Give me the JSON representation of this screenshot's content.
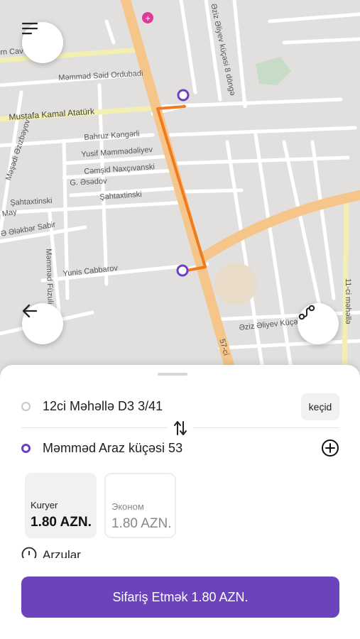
{
  "map": {
    "street_labels": [
      "Mustafa Kamal Atatürk",
      "Məmməd Səid Ordubadi",
      "Bahruz Kəngərli",
      "Yusif Məmmədəliyev",
      "Cəmşid Naxçıvanski",
      "G. Əsədov",
      "Şahtaxtinski",
      "Şahtaxtinski",
      "Yunis Cabbarov",
      "Məmməd Füzuli",
      "Əziz Əliyev küçəsi 8 döngə",
      "Əziz Əliyev Küçəsi",
      "Məşədi Əzizbəyov",
      "Ə Ələkbər Sabir",
      "11-ci məhəllə",
      "57-ci",
      "May",
      "rn Cav"
    ]
  },
  "controls": {
    "menu_icon": "hamburger-menu-icon",
    "back_icon": "arrow-left-icon",
    "route_icon": "route-icon"
  },
  "trip": {
    "pickup": "12ci Məhəllə D3 3/41",
    "destination": "Məmməd Araz küçəsi 53",
    "pickup_action": "keçid",
    "swap_icon": "swap-arrows-icon",
    "add_stop_icon": "plus-circle-icon"
  },
  "tariffs": [
    {
      "name": "Kuryer",
      "price": "1.80 AZN.",
      "selected": true
    },
    {
      "name": "Эконом",
      "price": "1.80 AZN.",
      "selected": false
    }
  ],
  "wishes_label": "Arzular",
  "order_button": "Sifariş Etmək 1.80 AZN.",
  "colors": {
    "accent": "#6b43bd",
    "route": "#f07a1e",
    "main_road": "#f5c58a",
    "park": "#c6dcc6"
  }
}
